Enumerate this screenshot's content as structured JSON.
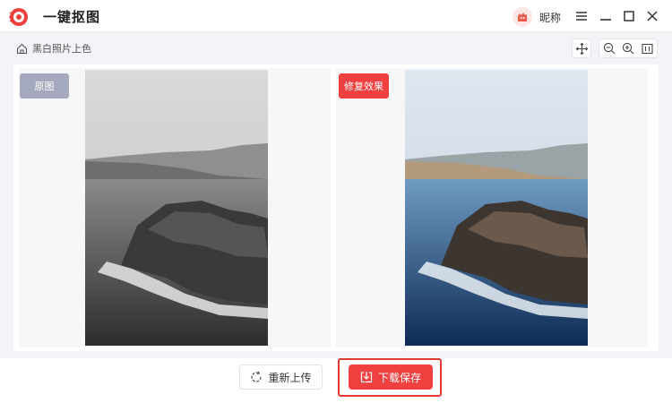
{
  "app": {
    "title": "一键抠图",
    "brand_color": "#ef3f3f"
  },
  "user": {
    "nickname": "昵称"
  },
  "window_controls": [
    "menu-icon",
    "minimize-icon",
    "maximize-icon",
    "close-icon"
  ],
  "breadcrumb": {
    "icon": "home-icon",
    "label": "黑白照片上色"
  },
  "toolbar": {
    "tools": [
      "move-icon",
      "zoom-out-icon",
      "zoom-in-icon",
      "fit-screen-icon"
    ]
  },
  "compare": {
    "original": {
      "label": "原图",
      "tag_color": "#a5a9be"
    },
    "result": {
      "label": "修复效果",
      "tag_color": "#ef3f3f"
    }
  },
  "actions": {
    "reupload_label": "重新上传",
    "download_label": "下载保存"
  }
}
